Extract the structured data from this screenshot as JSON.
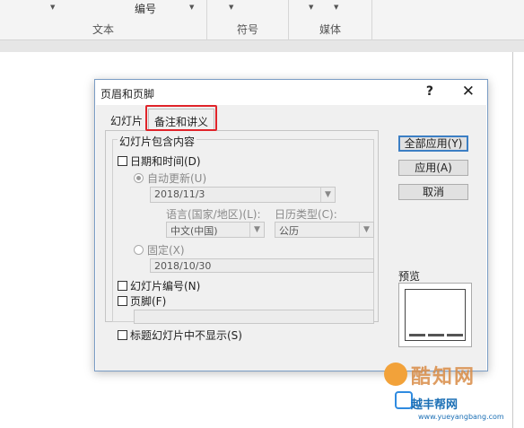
{
  "ribbon": {
    "group_labels": [
      "文本",
      "符号",
      "媒体"
    ],
    "numbering_label": "编号"
  },
  "dialog": {
    "title": "页眉和页脚",
    "help": "?",
    "close": "✕",
    "tabs": [
      {
        "label": "幻灯片",
        "active": false
      },
      {
        "label": "备注和讲义",
        "active": true
      }
    ],
    "group_title": "幻灯片包含内容",
    "date_time": {
      "label": "日期和时间(D)",
      "checked": false
    },
    "auto_update": {
      "label": "自动更新(U)",
      "selected": true,
      "value": "2018/11/3"
    },
    "language": {
      "label": "语言(国家/地区)(L):",
      "value": "中文(中国)"
    },
    "calendar": {
      "label": "日历类型(C):",
      "value": "公历"
    },
    "fixed": {
      "label": "固定(X)",
      "selected": false,
      "value": "2018/10/30"
    },
    "slide_number": {
      "label": "幻灯片编号(N)",
      "checked": false
    },
    "footer": {
      "label": "页脚(F)",
      "checked": false,
      "value": ""
    },
    "hide_title": {
      "label": "标题幻灯片中不显示(S)",
      "checked": false
    },
    "buttons": {
      "apply_all": "全部应用(Y)",
      "apply": "应用(A)",
      "cancel": "取消"
    },
    "preview_label": "预览"
  },
  "watermark": {
    "site1": "酷知网",
    "site2": "越丰帮网",
    "site2_url": "www.yueyangbang.com"
  },
  "colors": {
    "highlight": "#e0242a",
    "default_button_border": "#3c7fc4"
  }
}
